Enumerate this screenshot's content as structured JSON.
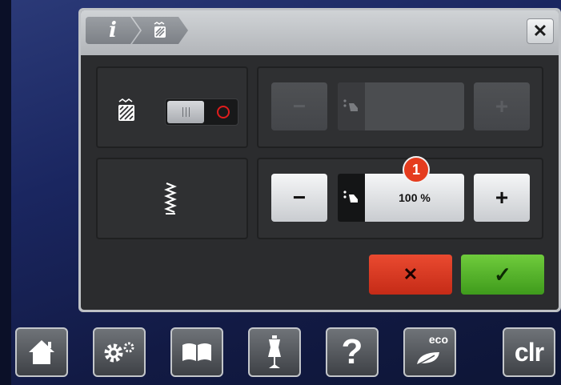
{
  "dialog": {
    "breadcrumb": [
      {
        "icon": "info-icon",
        "label": "i"
      },
      {
        "icon": "stitch-pattern-icon"
      }
    ],
    "close_label": "✕"
  },
  "top_row": {
    "toggle_state": "off",
    "minus_label": "−",
    "plus_label": "+",
    "enabled": false
  },
  "bottom_row": {
    "minus_label": "−",
    "plus_label": "+",
    "value_label": "100 %",
    "badge": "1"
  },
  "actions": {
    "cancel_label": "✕",
    "confirm_label": "✓",
    "cancel_color": "#d9321d",
    "confirm_color": "#4cae25"
  },
  "taskbar": [
    {
      "name": "home-icon"
    },
    {
      "name": "settings-icon"
    },
    {
      "name": "book-icon"
    },
    {
      "name": "mannequin-icon"
    },
    {
      "name": "help-icon",
      "label": "?"
    },
    {
      "name": "eco-icon",
      "label": "eco"
    },
    {
      "name": "clr-button",
      "label": "clr"
    }
  ]
}
